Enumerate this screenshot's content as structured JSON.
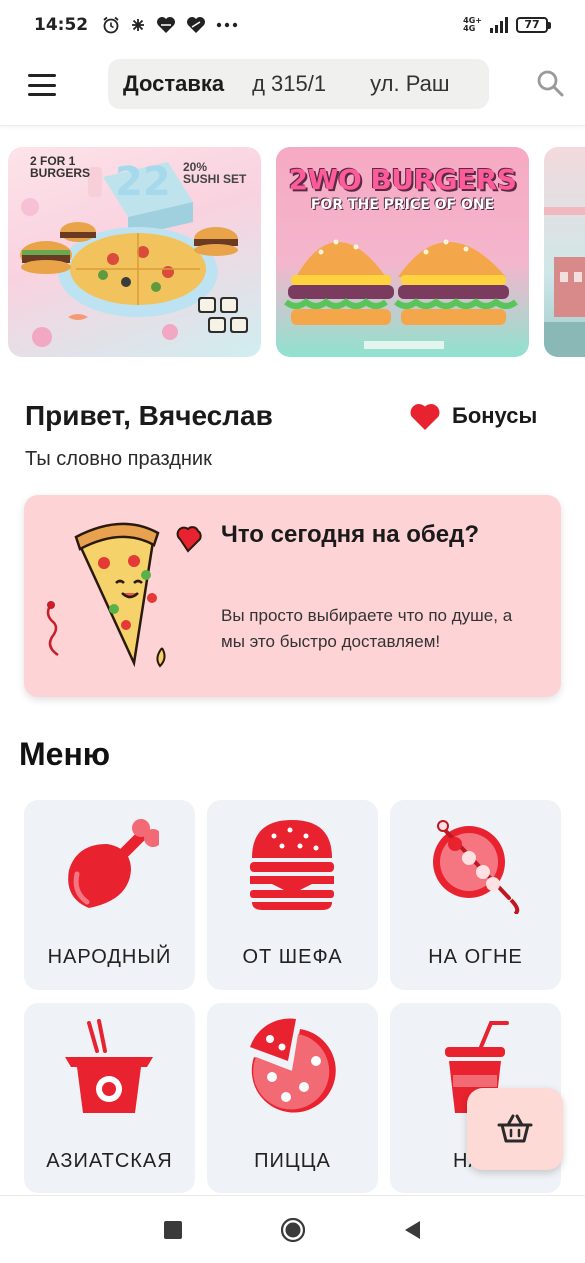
{
  "status_bar": {
    "time": "14:52",
    "network": [
      "4G+",
      "4G"
    ],
    "battery": "77"
  },
  "header": {
    "delivery_label": "Доставка",
    "address": "д 315/1",
    "street": "ул. Раш"
  },
  "banners": [
    {
      "line1": "2 FOR 1",
      "line2": "BURGERS",
      "percent": "20%",
      "percent_sub": "SUSHI SET"
    },
    {
      "title": "2WO BURGERS",
      "subtitle": "FOR THE PRICE OF ONE"
    }
  ],
  "greeting": {
    "title": "Привет, Вячеслав",
    "subtitle": "Ты словно праздник"
  },
  "bonus": {
    "label": "Бонусы"
  },
  "promo": {
    "title": "Что сегодня на обед?",
    "text": "Вы просто выбираете что по душе, а мы это быстро доставляем!"
  },
  "menu": {
    "title": "Меню",
    "categories": [
      {
        "label": "НАРОДНЫЙ",
        "icon": "chicken-leg-icon"
      },
      {
        "label": "ОТ ШЕФА",
        "icon": "burger-icon"
      },
      {
        "label": "НА ОГНЕ",
        "icon": "skewer-icon"
      },
      {
        "label": "АЗИАТСКАЯ",
        "icon": "noodle-box-icon"
      },
      {
        "label": "ПИЦЦА",
        "icon": "pizza-icon"
      },
      {
        "label": "НАП",
        "icon": "drink-icon"
      }
    ]
  },
  "colors": {
    "accent_red": "#e8232f",
    "promo_bg": "#fdd3d6",
    "tile_bg": "#eff2f6"
  }
}
